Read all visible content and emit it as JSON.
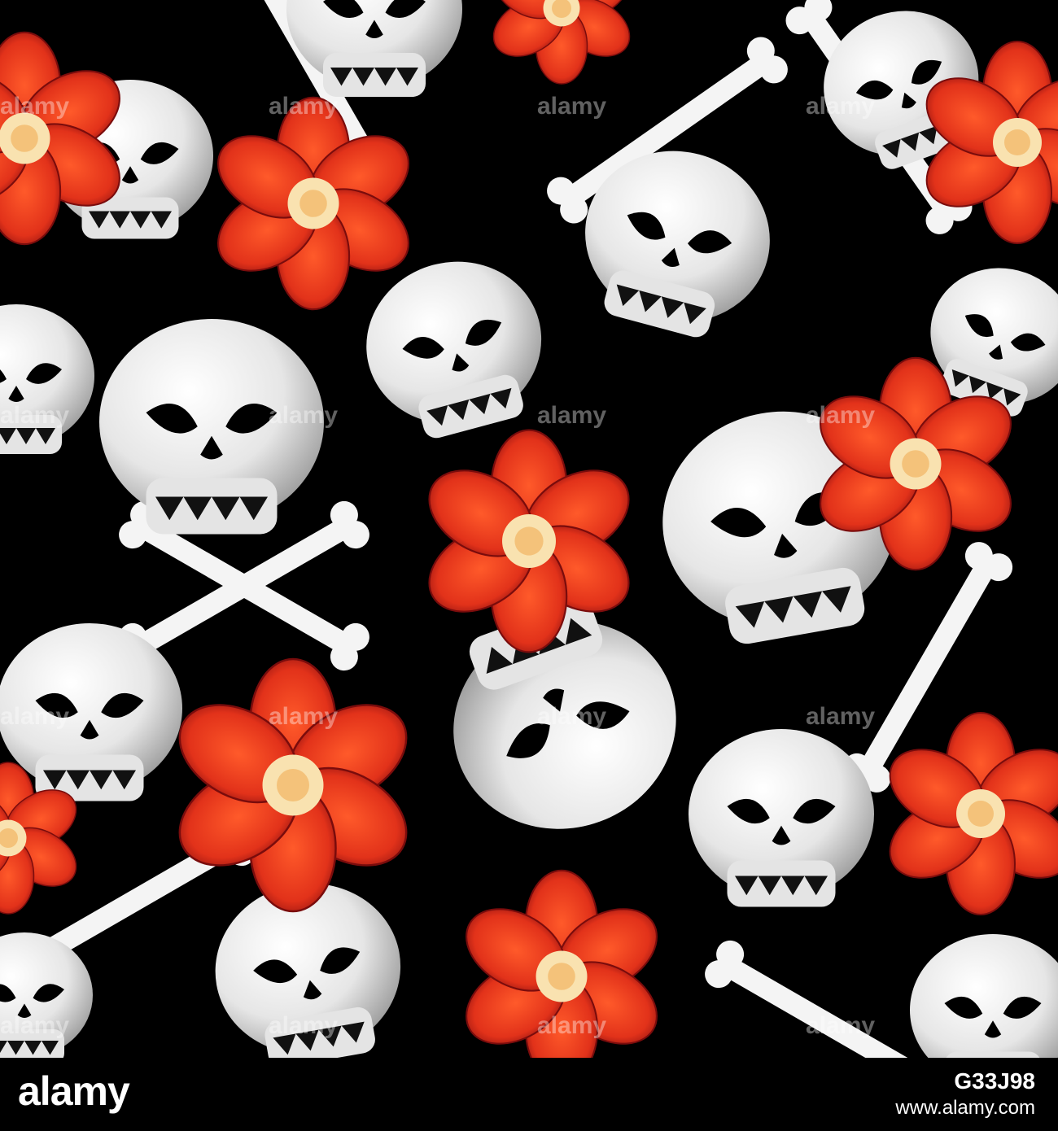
{
  "image": {
    "description_colors": {
      "background": "#000000",
      "skull": "#f2f2f2",
      "flower": "#e8321a",
      "flower_center": "#f7d9a0"
    }
  },
  "watermark": {
    "text": "alamy"
  },
  "footer": {
    "brand": "alamy",
    "image_id": "G33J98",
    "url": "www.alamy.com"
  }
}
